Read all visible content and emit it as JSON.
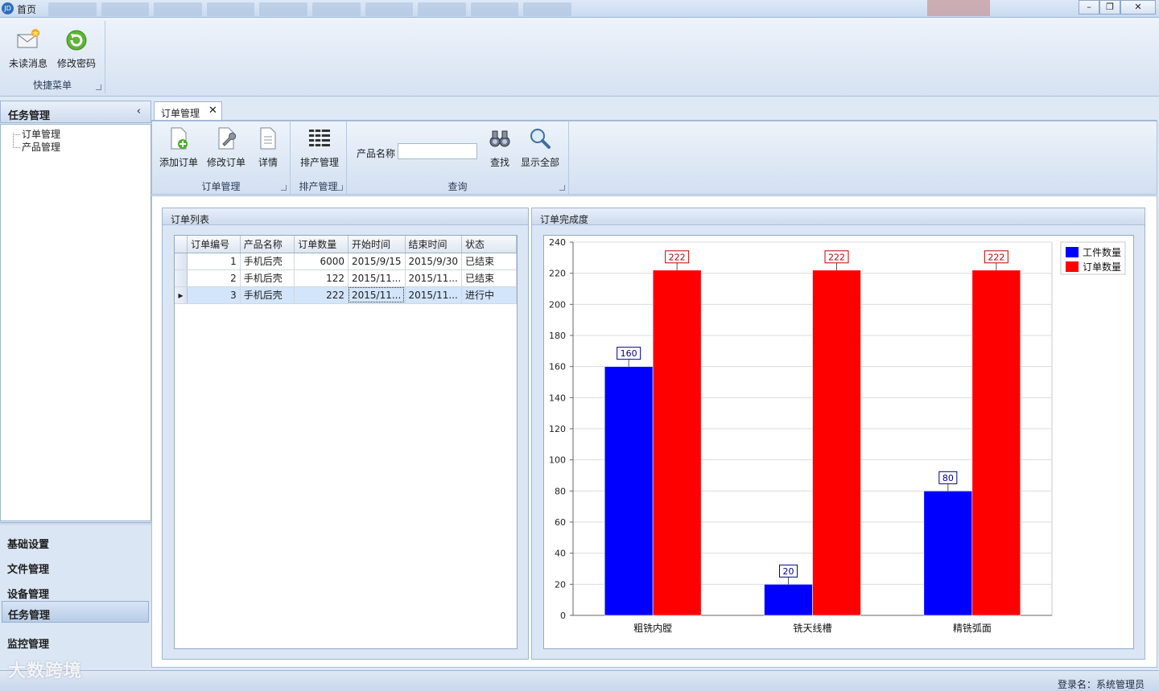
{
  "window": {
    "title": "首页"
  },
  "quick_menu": {
    "group_label": "快捷菜单",
    "unread_label": "未读消息",
    "password_label": "修改密码"
  },
  "sidebar": {
    "header": "任务管理",
    "tree": [
      "订单管理",
      "产品管理"
    ],
    "groups": [
      "基础设置",
      "文件管理",
      "设备管理",
      "任务管理",
      "监控管理"
    ],
    "active_group": "任务管理"
  },
  "tab": {
    "label": "订单管理",
    "close_glyph": "✕"
  },
  "toolbar": {
    "order_group": {
      "label": "订单管理",
      "add": "添加订单",
      "edit": "修改订单",
      "detail": "详情"
    },
    "schedule_group": {
      "label": "排产管理",
      "schedule": "排产管理"
    },
    "query_group": {
      "label": "查询",
      "product_name_label": "产品名称",
      "product_name_value": "",
      "find": "查找",
      "show_all": "显示全部"
    }
  },
  "order_list": {
    "title": "订单列表",
    "columns": [
      "订单编号",
      "产品名称",
      "订单数量",
      "开始时间",
      "结束时间",
      "状态"
    ],
    "rows": [
      {
        "id": "1",
        "product": "手机后壳",
        "qty": "6000",
        "start": "2015/9/15",
        "end": "2015/9/30",
        "status": "已结束"
      },
      {
        "id": "2",
        "product": "手机后壳",
        "qty": "122",
        "start": "2015/11...",
        "end": "2015/11...",
        "status": "已结束"
      },
      {
        "id": "3",
        "product": "手机后壳",
        "qty": "222",
        "start": "2015/11...",
        "end": "2015/11...",
        "status": "进行中"
      }
    ],
    "selected_row": 3
  },
  "completion_panel": {
    "title": "订单完成度"
  },
  "chart_data": {
    "type": "bar",
    "categories": [
      "粗铣内膛",
      "铣天线槽",
      "精铣弧面"
    ],
    "series": [
      {
        "name": "工件数量",
        "values": [
          160,
          20,
          80
        ],
        "color": "#0000ff"
      },
      {
        "name": "订单数量",
        "values": [
          222,
          222,
          222
        ],
        "color": "#ff0000"
      }
    ],
    "ylim": [
      0,
      240
    ],
    "yticks": [
      0,
      20,
      40,
      60,
      80,
      100,
      120,
      140,
      160,
      180,
      200,
      220,
      240
    ],
    "grid": true,
    "legend": "top-right",
    "label_colors": [
      "#00008b",
      "#c00000"
    ]
  },
  "status": {
    "login_text": "登录名：系统管理员"
  },
  "watermark": {
    "text": "大数跨境"
  }
}
